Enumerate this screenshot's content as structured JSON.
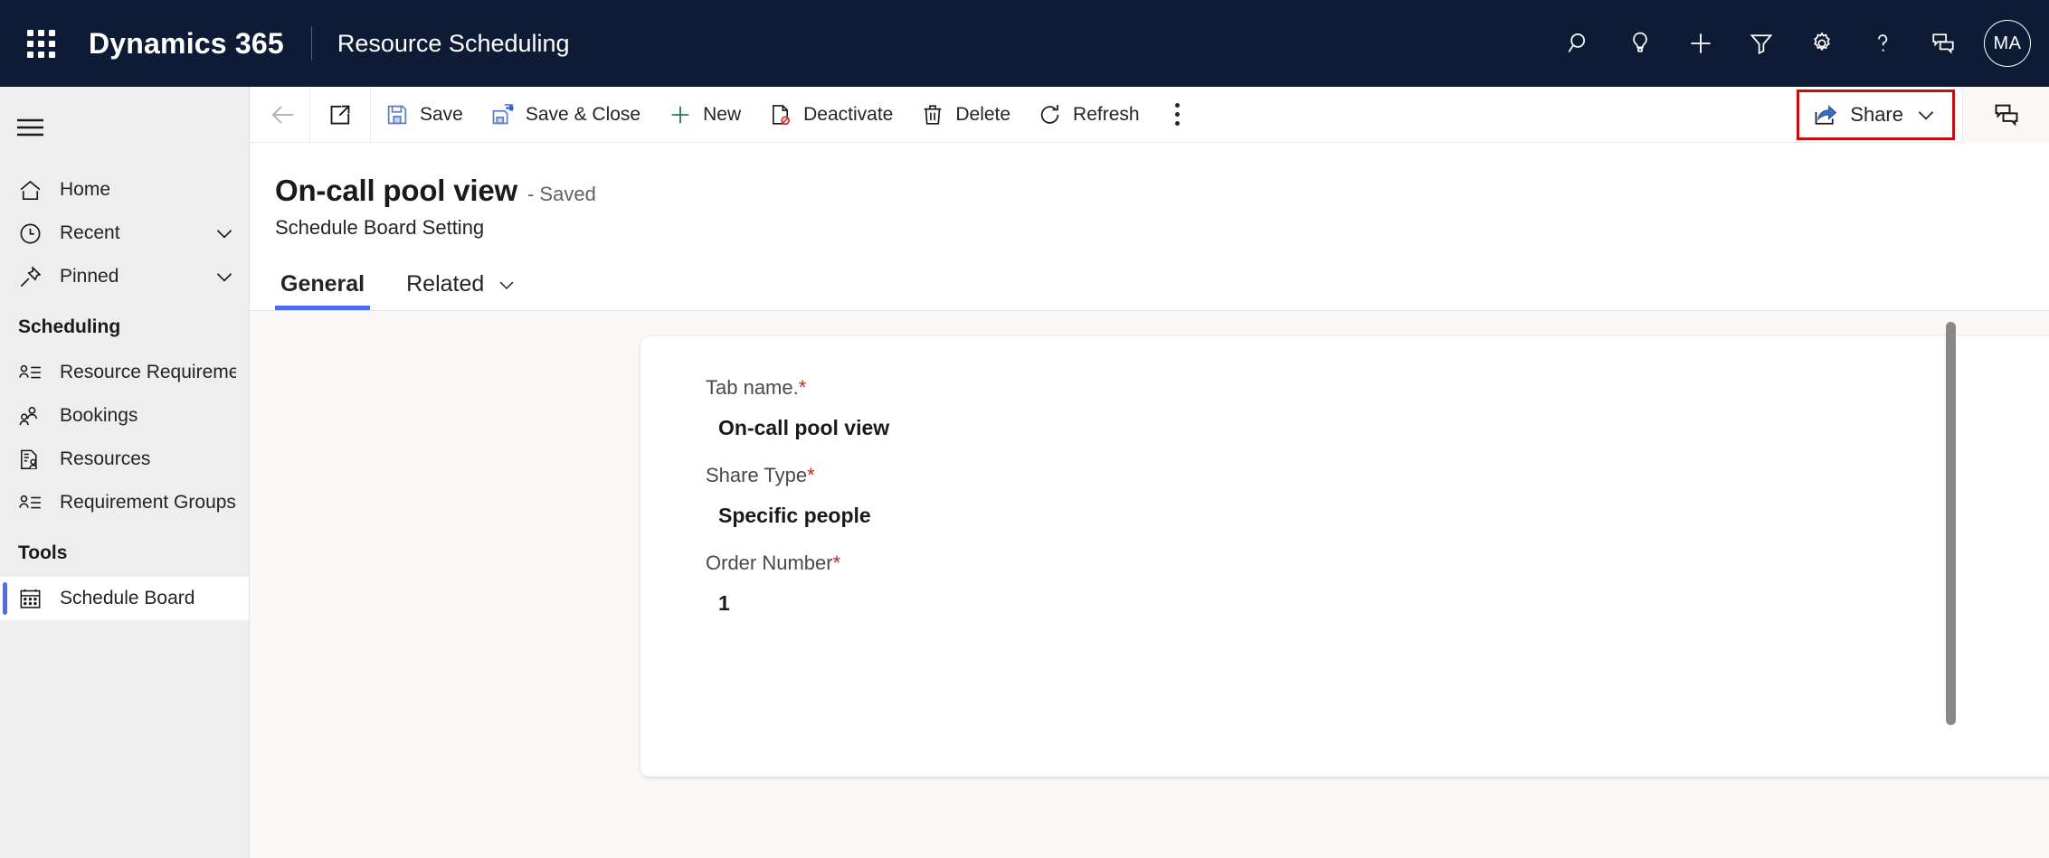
{
  "header": {
    "waffle_icon": "app-launcher-icon",
    "brand": "Dynamics 365",
    "app_name": "Resource Scheduling",
    "icons": [
      {
        "name": "search-icon",
        "label": "Search"
      },
      {
        "name": "lightbulb-icon",
        "label": "Ideas"
      },
      {
        "name": "plus-icon",
        "label": "Quick create"
      },
      {
        "name": "filter-icon",
        "label": "Filter"
      },
      {
        "name": "gear-icon",
        "label": "Settings"
      },
      {
        "name": "question-icon",
        "label": "Help"
      },
      {
        "name": "feedback-icon",
        "label": "Feedback"
      }
    ],
    "avatar_initials": "MA"
  },
  "sidebar": {
    "hamburger_icon": "hamburger-menu-icon",
    "top_items": [
      {
        "label": "Home",
        "icon": "home-icon",
        "chevron": false
      },
      {
        "label": "Recent",
        "icon": "clock-icon",
        "chevron": true
      },
      {
        "label": "Pinned",
        "icon": "pin-icon",
        "chevron": true
      }
    ],
    "groups": [
      {
        "title": "Scheduling",
        "items": [
          {
            "label": "Resource Requireme...",
            "icon": "person-list-icon",
            "selected": false
          },
          {
            "label": "Bookings",
            "icon": "people-icon",
            "selected": false
          },
          {
            "label": "Resources",
            "icon": "document-person-icon",
            "selected": false
          },
          {
            "label": "Requirement Groups",
            "icon": "person-list-icon",
            "selected": false
          }
        ]
      },
      {
        "title": "Tools",
        "items": [
          {
            "label": "Schedule Board",
            "icon": "calendar-icon",
            "selected": true
          }
        ]
      }
    ]
  },
  "commandbar": {
    "back_icon": "back-arrow-icon",
    "popout_icon": "open-in-new-window-icon",
    "buttons": [
      {
        "label": "Save",
        "icon": "save-floppy-icon"
      },
      {
        "label": "Save & Close",
        "icon": "save-and-close-icon"
      },
      {
        "label": "New",
        "icon": "plus-icon"
      },
      {
        "label": "Deactivate",
        "icon": "deactivate-icon"
      },
      {
        "label": "Delete",
        "icon": "trash-icon"
      },
      {
        "label": "Refresh",
        "icon": "refresh-icon"
      }
    ],
    "overflow_icon": "more-commands-icon",
    "share": {
      "label": "Share",
      "icon": "share-icon",
      "chevron_icon": "chevron-down-icon",
      "highlight_color": "#c20f0f"
    },
    "chat_icon": "chat-bubbles-icon"
  },
  "record": {
    "title": "On-call pool view",
    "status": "- Saved",
    "entity": "Schedule Board Setting",
    "tabs": [
      {
        "label": "General",
        "active": true,
        "chevron": false
      },
      {
        "label": "Related",
        "active": false,
        "chevron": true
      }
    ]
  },
  "form": {
    "fields": [
      {
        "label": "Tab name.",
        "required": "*",
        "value": "On-call pool view"
      },
      {
        "label": "Share Type",
        "required": "*",
        "value": "Specific people"
      },
      {
        "label": "Order Number",
        "required": "*",
        "value": "1"
      }
    ]
  },
  "colors": {
    "header_bg": "#0e1b35",
    "accent": "#4f6bed",
    "required": "#c4291c",
    "highlight": "#c20f0f",
    "sidebar_bg": "#efeeee"
  }
}
